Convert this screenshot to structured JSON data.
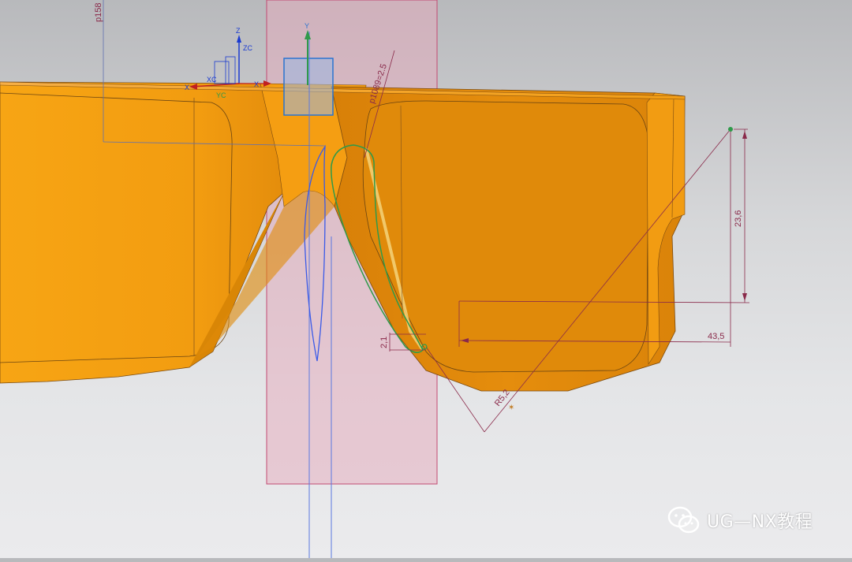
{
  "viewport": {
    "dimensions": {
      "top_depth": "p158",
      "angle": "p1089=2.5",
      "height": "23,6",
      "width": "43,5",
      "radius": "R5,2",
      "offset": "2,1"
    },
    "axes": {
      "y": "Y",
      "z": "Z",
      "zc": "ZC",
      "x": "X",
      "xc": "XC",
      "yc": "YC"
    }
  },
  "watermark": {
    "label": "UG—NX教程"
  },
  "colors": {
    "model": "#f49a10",
    "plane": "#d98aa0",
    "dimension": "#8a2a4a",
    "curve_blue": "#3a5ae8",
    "curve_green": "#2f9a4a"
  }
}
